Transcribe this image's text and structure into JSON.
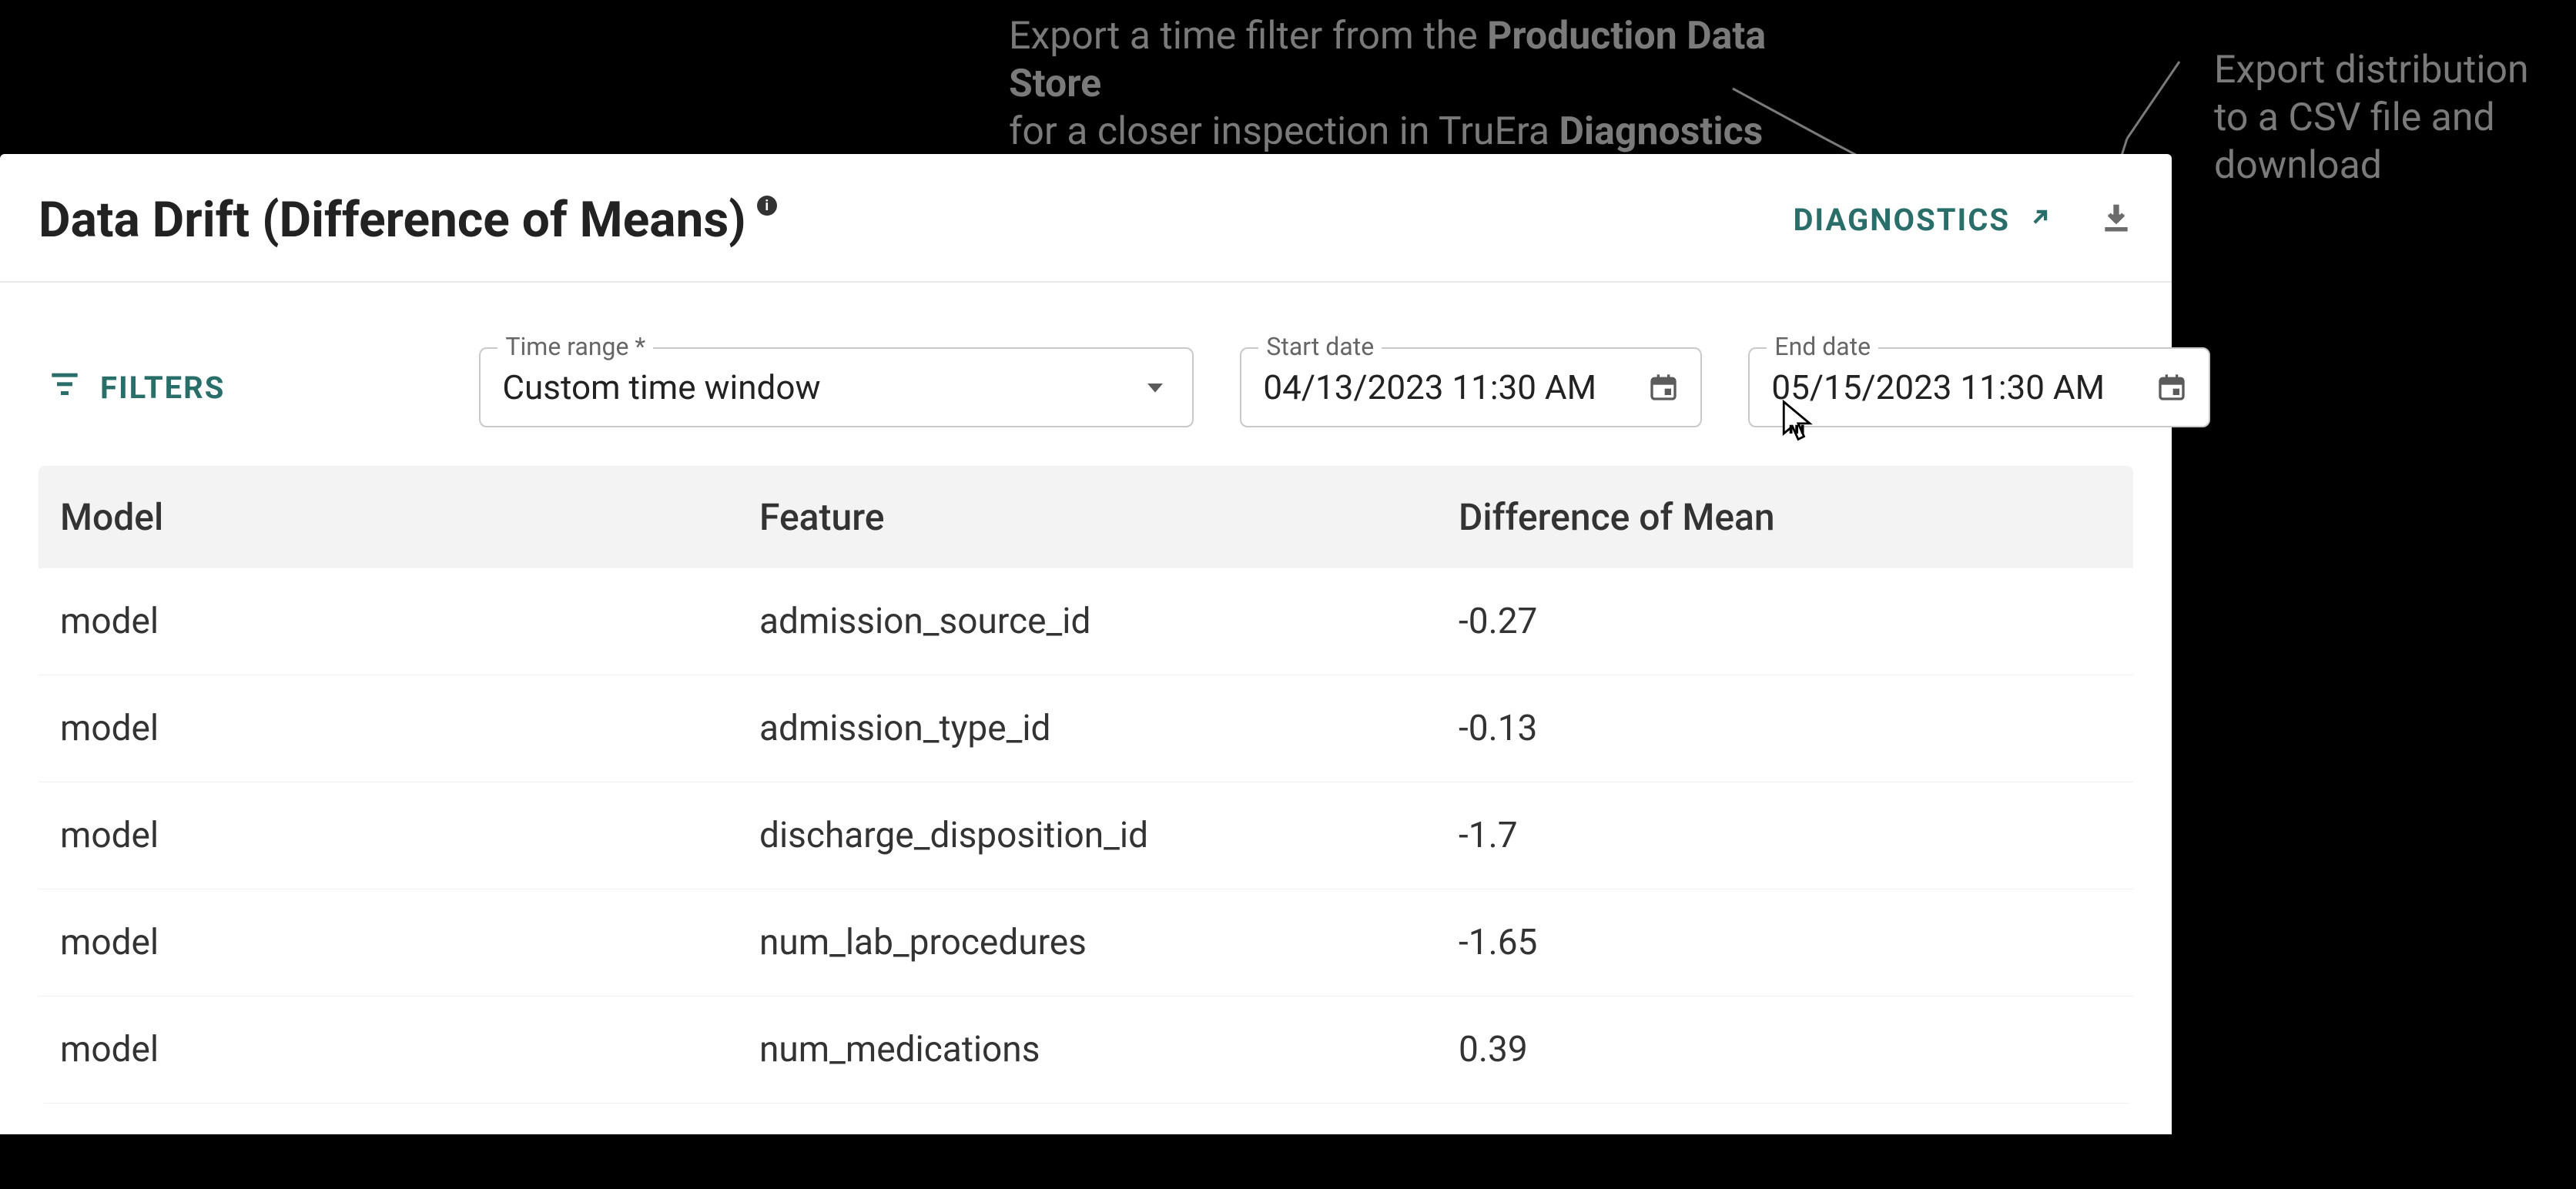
{
  "annotations": {
    "a1_line1": "Export a time filter from the ",
    "a1_strong1": "Production Data Store",
    "a1_line2": "for a closer inspection in TruEra ",
    "a1_strong2": "Diagnostics",
    "a2_line1": "Export distribution",
    "a2_line2": "to a CSV file and",
    "a2_line3": "download"
  },
  "header": {
    "title": "Data Drift (Difference of Means)",
    "diagnostics_label": "DIAGNOSTICS"
  },
  "filters": {
    "filters_label": "FILTERS",
    "time_range": {
      "label": "Time range *",
      "value": "Custom time window"
    },
    "start_date": {
      "label": "Start date",
      "value": "04/13/2023 11:30 AM"
    },
    "end_date": {
      "label": "End date",
      "value": "05/15/2023 11:30 AM"
    }
  },
  "table": {
    "headers": {
      "model": "Model",
      "feature": "Feature",
      "diff": "Difference of Mean"
    },
    "rows": [
      {
        "model": "model",
        "feature": "admission_source_id",
        "diff": "-0.27"
      },
      {
        "model": "model",
        "feature": "admission_type_id",
        "diff": "-0.13"
      },
      {
        "model": "model",
        "feature": "discharge_disposition_id",
        "diff": "-1.7"
      },
      {
        "model": "model",
        "feature": "num_lab_procedures",
        "diff": "-1.65"
      },
      {
        "model": "model",
        "feature": "num_medications",
        "diff": "0.39"
      }
    ]
  }
}
